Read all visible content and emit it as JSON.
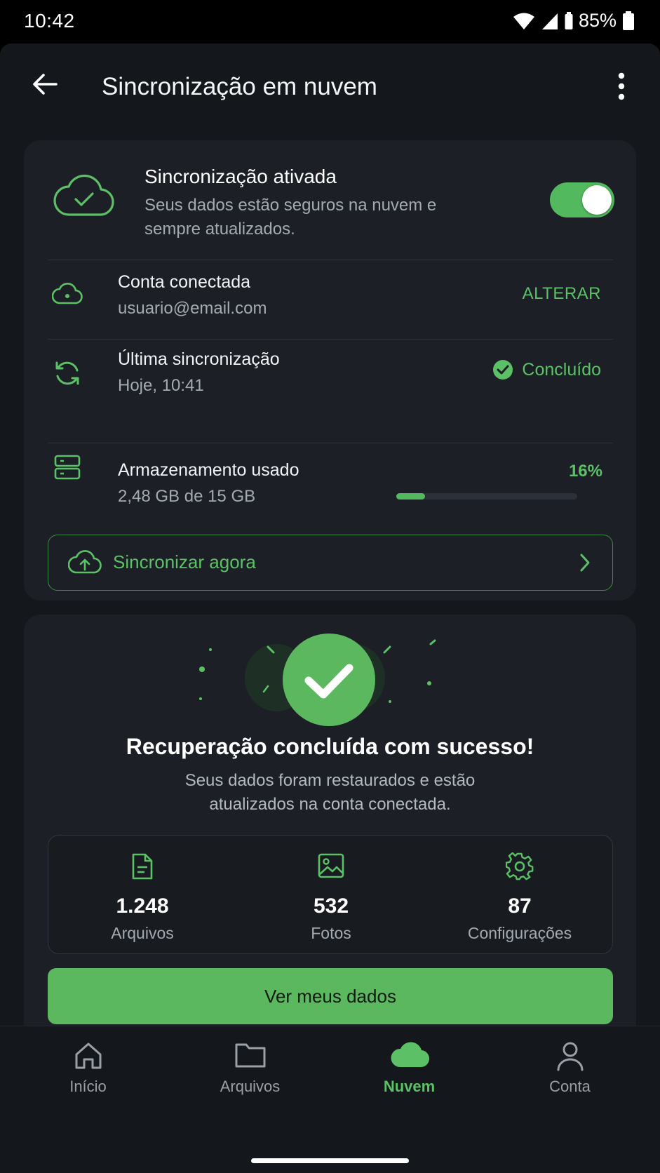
{
  "status_bar": {
    "time": "10:42",
    "battery": "85%"
  },
  "appbar": {
    "title": "Sincronização em nuvem",
    "back_icon": "arrow-left-icon",
    "menu_icon": "more-vert-icon"
  },
  "sync_card": {
    "status_title": "Sincronização ativada",
    "status_description": "Seus dados estão seguros na nuvem e sempre atualizados.",
    "toggle_on": true,
    "account": {
      "title": "Conta conectada",
      "email": "usuario@email.com",
      "action": "ALTERAR"
    },
    "last_sync": {
      "title": "Última sincronização",
      "time": "Hoje, 10:41",
      "status": "Concluído"
    },
    "storage": {
      "title": "Armazenamento usado",
      "usage": "2,48 GB de 15 GB",
      "percent_label": "16%",
      "percent_value": 0.16
    },
    "sync_now_label": "Sincronizar agora"
  },
  "recovery_card": {
    "title": "Recuperação concluída com sucesso!",
    "description": "Seus dados foram restaurados e estão atualizados na conta conectada.",
    "stats": [
      {
        "icon": "file-icon",
        "value": "1.248",
        "label": "Arquivos"
      },
      {
        "icon": "image-icon",
        "value": "532",
        "label": "Fotos"
      },
      {
        "icon": "gear-icon",
        "value": "87",
        "label": "Configurações"
      }
    ],
    "primary_button": "Ver meus dados"
  },
  "bottom_nav": {
    "items": [
      {
        "label": "Início",
        "icon": "home-icon",
        "active": false
      },
      {
        "label": "Arquivos",
        "icon": "folder-icon",
        "active": false
      },
      {
        "label": "Nuvem",
        "icon": "cloud-icon",
        "active": true
      },
      {
        "label": "Conta",
        "icon": "person-icon",
        "active": false
      }
    ]
  },
  "colors": {
    "accent": "#5cc066",
    "background": "#14171b",
    "card": "#1c2026"
  }
}
